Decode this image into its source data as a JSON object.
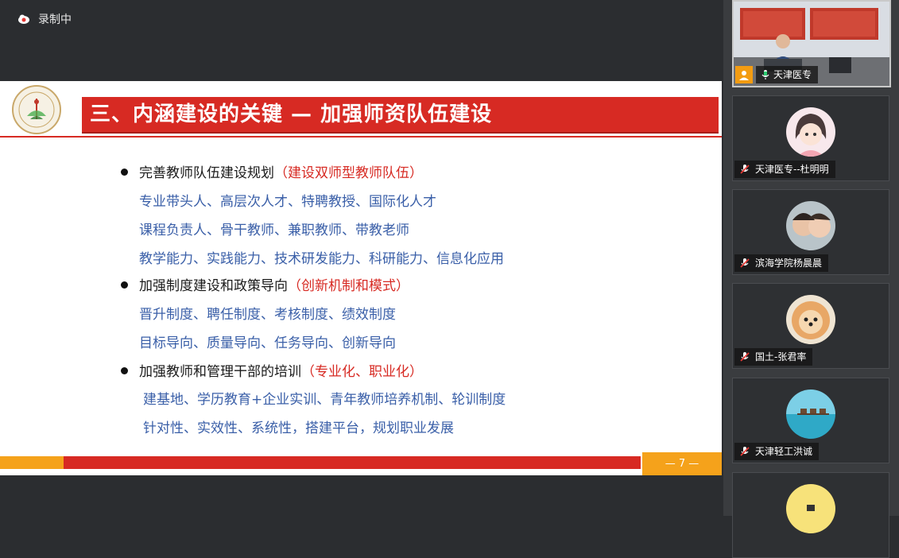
{
  "recording": {
    "label": "录制中"
  },
  "slide": {
    "title": "三、内涵建设的关键 — 加强师资队伍建设",
    "sections": [
      {
        "heading": "完善教师队伍建设规划",
        "highlight": "（建设双师型教师队伍）",
        "lines": [
          "专业带头人、高层次人才、特聘教授、国际化人才",
          "课程负责人、骨干教师、兼职教师、带教老师",
          "教学能力、实践能力、技术研发能力、科研能力、信息化应用"
        ]
      },
      {
        "heading": "加强制度建设和政策导向",
        "highlight": "（创新机制和模式）",
        "lines": [
          "晋升制度、聘任制度、考核制度、绩效制度",
          "目标导向、质量导向、任务导向、创新导向"
        ]
      },
      {
        "heading": "加强教师和管理干部的培训",
        "highlight": "（专业化、职业化）",
        "lines": [
          "建基地、学历教育+企业实训、青年教师培养机制、轮训制度",
          "针对性、实效性、系统性，搭建平台，规划职业发展"
        ]
      }
    ],
    "page_number": "— 7 —"
  },
  "participants": [
    {
      "name": "天津医专",
      "type": "video",
      "mic": "on"
    },
    {
      "name": "天津医专--杜明明",
      "type": "avatar",
      "mic": "muted"
    },
    {
      "name": "滨海学院杨晨晨",
      "type": "avatar",
      "mic": "muted"
    },
    {
      "name": "国土-张君率",
      "type": "avatar",
      "mic": "muted"
    },
    {
      "name": "天津轻工洪诚",
      "type": "avatar",
      "mic": "muted"
    },
    {
      "name": "",
      "type": "avatar",
      "mic": "muted"
    }
  ],
  "colors": {
    "accent_red": "#d72a23",
    "accent_orange": "#f5a21b",
    "body_blue": "#3a5fa8"
  }
}
